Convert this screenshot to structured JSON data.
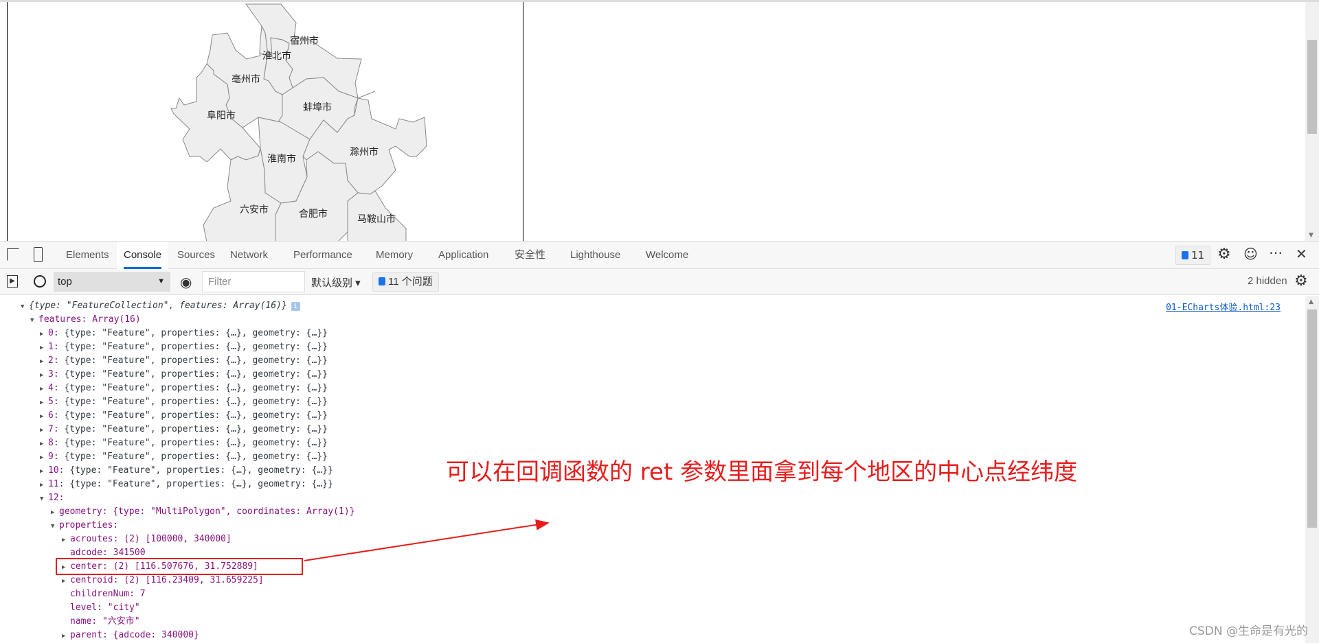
{
  "map": {
    "regions": [
      "宿州市",
      "淮北市",
      "亳州市",
      "蚌埠市",
      "阜阳市",
      "淮南市",
      "滁州市",
      "六安市",
      "合肥市",
      "马鞍山市"
    ],
    "fill": "#eeeeee",
    "stroke": "#888888"
  },
  "devtools": {
    "tabs": [
      "Elements",
      "Console",
      "Sources",
      "Network",
      "Performance",
      "Memory",
      "Application",
      "安全性",
      "Lighthouse",
      "Welcome"
    ],
    "active_tab": "Console",
    "issues_badge": "11",
    "toolbar": {
      "context": "top",
      "filter_placeholder": "Filter",
      "levels": "默认级别",
      "issues": "11 个问题",
      "hidden": "2 hidden"
    },
    "source_link": "01-ECharts体验.html:23"
  },
  "console": {
    "root": "{type: \"FeatureCollection\", features: Array(16)}",
    "features_label": "features: Array(16)",
    "collapsed_items": [
      "0",
      "1",
      "2",
      "3",
      "4",
      "5",
      "6",
      "7",
      "8",
      "9",
      "10",
      "11"
    ],
    "collapsed_item_body": "{type: \"Feature\", properties: {…}, geometry: {…}}",
    "item12": {
      "index": "12:",
      "geometry": "geometry: {type: \"MultiPolygon\", coordinates: Array(1)}",
      "properties": "properties:",
      "acroutes": "acroutes: (2) [100000, 340000]",
      "adcode": "adcode: 341500",
      "center": "center: (2) [116.507676, 31.752889]",
      "centroid": "centroid: (2) [116.23409, 31.659225]",
      "childrenNum": "childrenNum: 7",
      "level": "level: \"city\"",
      "name": "name: \"六安市\"",
      "parent": "parent: {adcode: 340000}"
    }
  },
  "annotation": {
    "text": "可以在回调函数的 ret 参数里面拿到每个地区的中心点经纬度",
    "color": "#e81c1c"
  },
  "watermark": "CSDN @生命是有光的"
}
